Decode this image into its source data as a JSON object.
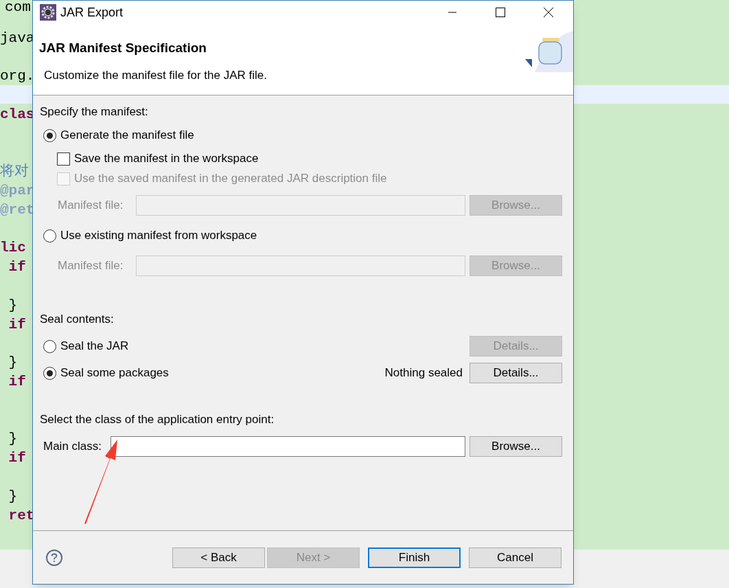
{
  "editor": {
    "lines": [
      {
        "text": "com",
        "kind": "plain"
      },
      {
        "text": "java",
        "kind": "plain"
      },
      {
        "text": "org.",
        "kind": "plain"
      },
      {
        "text": "clas",
        "kind": "keyword"
      },
      {
        "text": "将对",
        "kind": "comment"
      },
      {
        "text": "@par",
        "kind": "annotation"
      },
      {
        "text": "@ret",
        "kind": "annotation"
      },
      {
        "text": "lic",
        "kind": "keyword"
      },
      {
        "text": " if",
        "kind": "keyword"
      },
      {
        "text": " }",
        "kind": "plain"
      },
      {
        "text": " if",
        "kind": "keyword"
      },
      {
        "text": " }",
        "kind": "plain"
      },
      {
        "text": " if",
        "kind": "keyword"
      },
      {
        "text": " }",
        "kind": "plain"
      },
      {
        "text": " if",
        "kind": "keyword"
      },
      {
        "text": " }",
        "kind": "plain"
      },
      {
        "text": " ret",
        "kind": "keyword"
      }
    ]
  },
  "dialog": {
    "title": "JAR Export",
    "header": {
      "title": "JAR Manifest Specification",
      "description": "Customize the manifest file for the JAR file."
    },
    "manifest": {
      "label": "Specify the manifest:",
      "generate": {
        "label": "Generate the manifest file",
        "selected": true
      },
      "save_checkbox": {
        "label": "Save the manifest in the workspace",
        "checked": false,
        "disabled": false
      },
      "use_saved_checkbox": {
        "label": "Use the saved manifest in the generated JAR description file",
        "checked": false,
        "disabled": true
      },
      "generate_file": {
        "label": "Manifest file:",
        "disabled": true,
        "button": "Browse...",
        "button_disabled": true
      },
      "existing": {
        "label": "Use existing manifest from workspace",
        "selected": false
      },
      "existing_file": {
        "label": "Manifest file:",
        "disabled": true,
        "button": "Browse...",
        "button_disabled": true
      }
    },
    "seal": {
      "label": "Seal contents:",
      "options": [
        {
          "label": "Seal the JAR",
          "selected": false,
          "button": "Details...",
          "button_disabled": true
        },
        {
          "label": "Seal some packages",
          "selected": true,
          "status": "Nothing sealed",
          "button": "Details...",
          "button_disabled": false
        }
      ]
    },
    "entry_point": {
      "label": "Select the class of the application entry point:",
      "field_label": "Main class:",
      "button": "Browse...",
      "button_disabled": false
    },
    "buttons": [
      {
        "label": "< Back",
        "disabled": false,
        "default": false
      },
      {
        "label": "Next >",
        "disabled": true,
        "default": false
      },
      {
        "label": "Finish",
        "disabled": false,
        "default": true
      },
      {
        "label": "Cancel",
        "disabled": false,
        "default": false
      }
    ]
  }
}
